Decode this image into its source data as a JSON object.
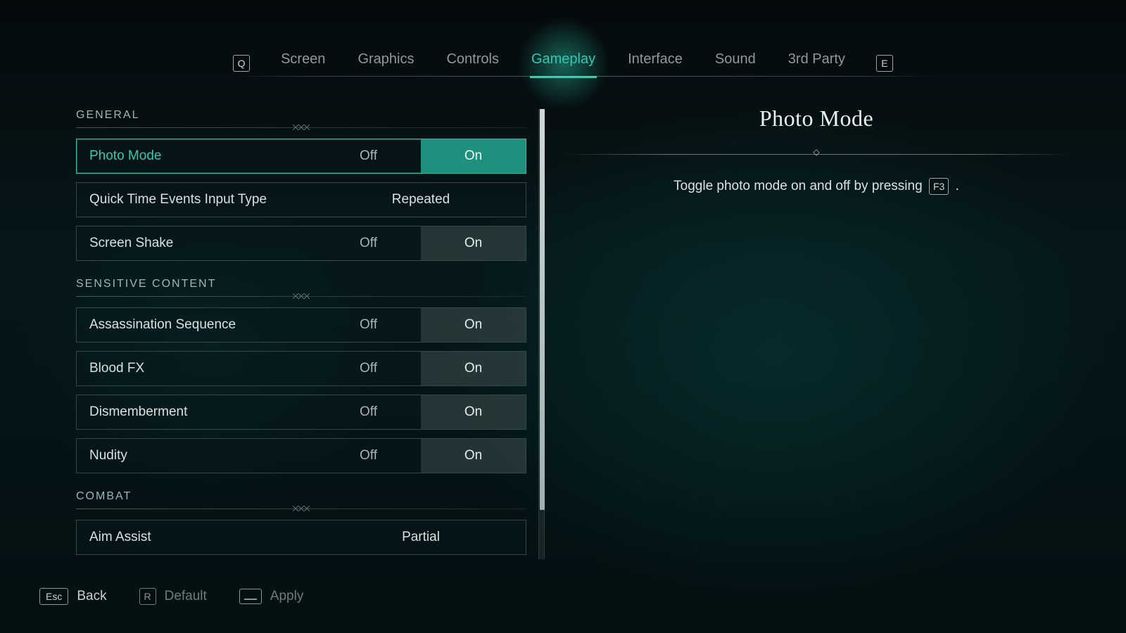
{
  "nav": {
    "prev_key": "Q",
    "next_key": "E",
    "tabs": [
      "Screen",
      "Graphics",
      "Controls",
      "Gameplay",
      "Interface",
      "Sound",
      "3rd Party"
    ],
    "active_index": 3
  },
  "sections": [
    {
      "title": "GENERAL",
      "rows": [
        {
          "id": "photo-mode",
          "label": "Photo Mode",
          "type": "toggle",
          "options": [
            "Off",
            "On"
          ],
          "selected": 1,
          "highlight": true
        },
        {
          "id": "qte-input-type",
          "label": "Quick Time Events Input Type",
          "type": "value",
          "value": "Repeated"
        },
        {
          "id": "screen-shake",
          "label": "Screen Shake",
          "type": "toggle",
          "options": [
            "Off",
            "On"
          ],
          "selected": 1
        }
      ]
    },
    {
      "title": "SENSITIVE CONTENT",
      "rows": [
        {
          "id": "assassination-sequence",
          "label": "Assassination Sequence",
          "type": "toggle",
          "options": [
            "Off",
            "On"
          ],
          "selected": 1
        },
        {
          "id": "blood-fx",
          "label": "Blood FX",
          "type": "toggle",
          "options": [
            "Off",
            "On"
          ],
          "selected": 1
        },
        {
          "id": "dismemberment",
          "label": "Dismemberment",
          "type": "toggle",
          "options": [
            "Off",
            "On"
          ],
          "selected": 1
        },
        {
          "id": "nudity",
          "label": "Nudity",
          "type": "toggle",
          "options": [
            "Off",
            "On"
          ],
          "selected": 1
        }
      ]
    },
    {
      "title": "COMBAT",
      "rows": [
        {
          "id": "aim-assist",
          "label": "Aim Assist",
          "type": "value",
          "value": "Partial"
        }
      ]
    }
  ],
  "detail": {
    "title": "Photo Mode",
    "desc_before": "Toggle photo mode on and off by pressing",
    "desc_key": "F3",
    "desc_after": "."
  },
  "footer": {
    "back": {
      "key": "Esc",
      "label": "Back"
    },
    "default": {
      "key": "R",
      "label": "Default"
    },
    "apply": {
      "label": "Apply"
    }
  }
}
